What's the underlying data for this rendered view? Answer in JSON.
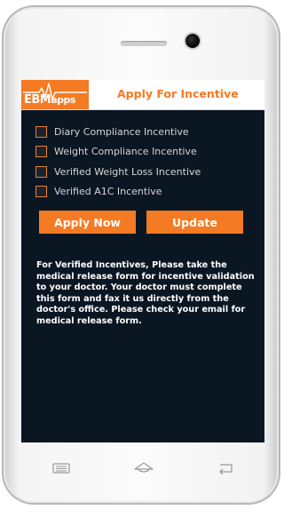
{
  "header": {
    "logo_text_main": "EBM",
    "logo_text_small": "apps",
    "title": "Apply For Incentive"
  },
  "incentives": [
    {
      "label": "Diary Compliance Incentive",
      "checked": false
    },
    {
      "label": "Weight Compliance Incentive",
      "checked": false
    },
    {
      "label": "Verified Weight Loss Incentive",
      "checked": false
    },
    {
      "label": "Verified A1C Incentive",
      "checked": false
    }
  ],
  "buttons": {
    "apply_label": "Apply Now",
    "update_label": "Update"
  },
  "info_text": "For Verified Incentives, Please take the medical release form for incentive validation to your doctor. Your doctor must complete this form and fax it us directly from the doctor's office. Please check your email for medical release form.",
  "colors": {
    "accent": "#f47a24",
    "background": "#0b1623",
    "text": "#ffffff"
  },
  "nav_icons": [
    "menu-icon",
    "home-icon",
    "back-icon"
  ]
}
